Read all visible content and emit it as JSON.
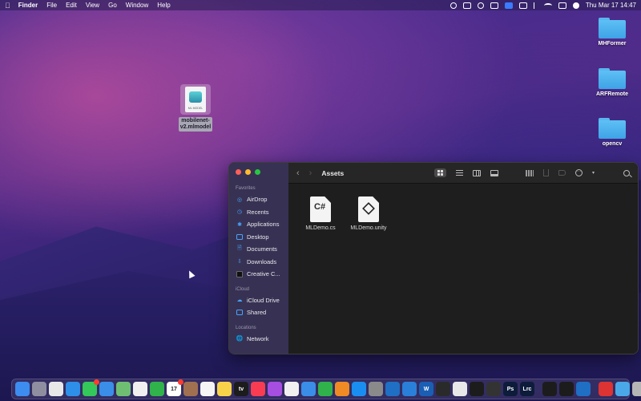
{
  "menubar": {
    "app_name": "Finder",
    "menus": [
      "File",
      "Edit",
      "View",
      "Go",
      "Window",
      "Help"
    ],
    "clock": "Thu Mar 17  14:47"
  },
  "desktop": {
    "folders": [
      {
        "label": "MHFormer"
      },
      {
        "label": "ARFRemote"
      },
      {
        "label": "opencv"
      }
    ],
    "model_file": {
      "label_line1": "mobilenet-",
      "label_line2": "v2.mlmodel",
      "badge_text": "ML MODEL"
    }
  },
  "finder": {
    "title": "Assets",
    "sidebar": {
      "favorites_header": "Favorites",
      "favorites": [
        {
          "label": "AirDrop",
          "icon": "airdrop-icon"
        },
        {
          "label": "Recents",
          "icon": "clock-icon"
        },
        {
          "label": "Applications",
          "icon": "applications-icon"
        },
        {
          "label": "Desktop",
          "icon": "desktop-icon"
        },
        {
          "label": "Documents",
          "icon": "document-icon"
        },
        {
          "label": "Downloads",
          "icon": "download-icon"
        },
        {
          "label": "Creative C...",
          "icon": "creative-cloud-icon"
        }
      ],
      "icloud_header": "iCloud",
      "icloud": [
        {
          "label": "iCloud Drive",
          "icon": "cloud-icon"
        },
        {
          "label": "Shared",
          "icon": "shared-folder-icon"
        }
      ],
      "locations_header": "Locations",
      "locations": [
        {
          "label": "Network",
          "icon": "network-icon"
        }
      ]
    },
    "files": [
      {
        "name": "MLDemo.cs",
        "type": "csharp",
        "mark": "C#"
      },
      {
        "name": "MLDemo.unity",
        "type": "unity"
      }
    ]
  },
  "dock": {
    "apps": [
      {
        "name": "finder-icon",
        "color": "#3d8cf0",
        "label": ""
      },
      {
        "name": "launchpad-icon",
        "color": "#8e8ea0",
        "label": ""
      },
      {
        "name": "chrome-icon",
        "color": "#e8e8e8",
        "label": ""
      },
      {
        "name": "safari-icon",
        "color": "#2d8fe8",
        "label": ""
      },
      {
        "name": "messages-icon",
        "color": "#34c759",
        "label": ""
      },
      {
        "name": "mail-icon",
        "color": "#3a8ee8",
        "label": ""
      },
      {
        "name": "maps-icon",
        "color": "#6fbf73",
        "label": ""
      },
      {
        "name": "photos-icon",
        "color": "#f0f0f0",
        "label": ""
      },
      {
        "name": "facetime-icon",
        "color": "#2fb34a",
        "label": ""
      },
      {
        "name": "calendar-icon",
        "color": "#ffffff",
        "label": "17"
      },
      {
        "name": "brown-app-icon",
        "color": "#a07050",
        "label": ""
      },
      {
        "name": "reminders-icon",
        "color": "#f5f5f5",
        "label": ""
      },
      {
        "name": "notes-icon",
        "color": "#f7d34a",
        "label": ""
      },
      {
        "name": "apple-tv-icon",
        "color": "#1c1c1c",
        "label": "tv"
      },
      {
        "name": "music-icon",
        "color": "#fa3c52",
        "label": ""
      },
      {
        "name": "podcasts-icon",
        "color": "#a64ee0",
        "label": ""
      },
      {
        "name": "news-icon",
        "color": "#f0f0f0",
        "label": ""
      },
      {
        "name": "keynote-icon",
        "color": "#3a8ee8",
        "label": ""
      },
      {
        "name": "numbers-icon",
        "color": "#2fb34a",
        "label": ""
      },
      {
        "name": "pages-icon",
        "color": "#f08a24",
        "label": ""
      },
      {
        "name": "app-store-icon",
        "color": "#1a8ef0",
        "label": ""
      },
      {
        "name": "settings-icon",
        "color": "#8a8a8a",
        "label": ""
      },
      {
        "name": "vscode-icon",
        "color": "#1f6fc4",
        "label": ""
      },
      {
        "name": "xcode-icon",
        "color": "#2a7fd8",
        "label": ""
      },
      {
        "name": "w-app-icon",
        "color": "#1a5fb4",
        "label": "W"
      },
      {
        "name": "unity-hub-icon",
        "color": "#2a2a2a",
        "label": ""
      },
      {
        "name": "blender-icon",
        "color": "#e8e8e8",
        "label": ""
      },
      {
        "name": "terminal-icon",
        "color": "#1c1c1c",
        "label": ""
      },
      {
        "name": "sketch-icon",
        "color": "#333",
        "label": ""
      },
      {
        "name": "photoshop-icon",
        "color": "#0e1c3b",
        "label": "Ps"
      },
      {
        "name": "lightroom-icon",
        "color": "#0e1c3b",
        "label": "Lrc"
      },
      {
        "name": "unity-icon",
        "color": "#1c1c1c",
        "label": ""
      },
      {
        "name": "unity-icon-2",
        "color": "#1c1c1c",
        "label": ""
      },
      {
        "name": "vscode-icon-2",
        "color": "#1f6fc4",
        "label": ""
      },
      {
        "name": "screen-record-icon",
        "color": "#d33",
        "label": ""
      },
      {
        "name": "folder-stack-icon",
        "color": "#4aa8e8",
        "label": ""
      },
      {
        "name": "trash-icon",
        "color": "#b5b5b5",
        "label": ""
      }
    ]
  }
}
